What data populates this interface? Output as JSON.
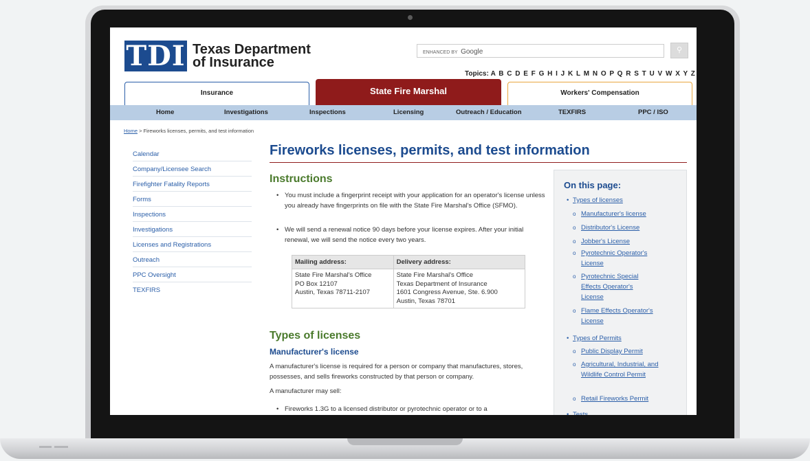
{
  "site": {
    "logo_mark": "TDI",
    "logo_line1": "Texas Department",
    "logo_line2": "of Insurance",
    "search_brand": "ENHANCED BY",
    "search_google": "Google",
    "search_icon": "search-icon",
    "topics_label": "Topics:",
    "topics_letters": "A B C D E F G H I J K L M N O P Q R S T U V W X Y Z All"
  },
  "tabs": {
    "insurance": "Insurance",
    "sfm": "State Fire Marshal",
    "wc": "Workers' Compensation"
  },
  "nav": [
    "Home",
    "Investigations",
    "Inspections",
    "Licensing",
    "Outreach / Education",
    "TEXFIRS",
    "PPC / ISO"
  ],
  "breadcrumb": {
    "home": "Home",
    "rest": " > Fireworks licenses, permits, and test information"
  },
  "sidenav": [
    "Calendar",
    "Company/Licensee Search",
    "Firefighter Fatality Reports",
    "Forms",
    "Inspections",
    "Investigations",
    "Licenses and Registrations",
    "Outreach",
    "PPC Oversight",
    "TEXFIRS"
  ],
  "page": {
    "title": "Fireworks licenses, permits, and test information",
    "instructions_heading": "Instructions",
    "bullet1": "You must include a fingerprint receipt with your application for an operator's license unless you already have fingerprints on file with the State Fire Marshal's Office (SFMO).",
    "bullet2": "We will send a renewal notice 90 days before your license expires. After your initial renewal, we will send the notice every two years.",
    "addr_mail_h": "Mailing address:",
    "addr_deliv_h": "Delivery address:",
    "addr_mail": [
      "State Fire Marshal's Office",
      "PO Box 12107",
      "Austin, Texas 78711-2107"
    ],
    "addr_deliv": [
      "State Fire Marshal's Office",
      "Texas Department of Insurance",
      "1601 Congress Avenue, Ste. 6.900",
      "Austin, Texas 78701"
    ],
    "types_heading": "Types of licenses",
    "manu_heading": "Manufacturer's license",
    "manu_text": "A manufacturer's license is required for a person or company that manufactures, stores, possesses, and sells fireworks constructed by that person or company.",
    "manu_may": "A manufacturer may sell:",
    "manu_bullet": "Fireworks 1.3G to a licensed distributor or pyrotechnic operator or to a"
  },
  "toc": {
    "heading": "On this page:",
    "types": "Types of licenses",
    "manu": "Manufacturer's license",
    "dist": "Distributor's License",
    "jobber": "Jobber's License",
    "pyro_op": "Pyrotechnic Operator's License",
    "pyro_sfx": "Pyrotechnic Special Effects Operator's License",
    "flame": "Flame Effects Operator's License",
    "permits": "Types of Permits",
    "public": "Public Display Permit",
    "agri": "Agricultural, Industrial, and Wildlife Control Permit",
    "retail": "Retail Fireworks Permit",
    "tests": "Tests"
  }
}
